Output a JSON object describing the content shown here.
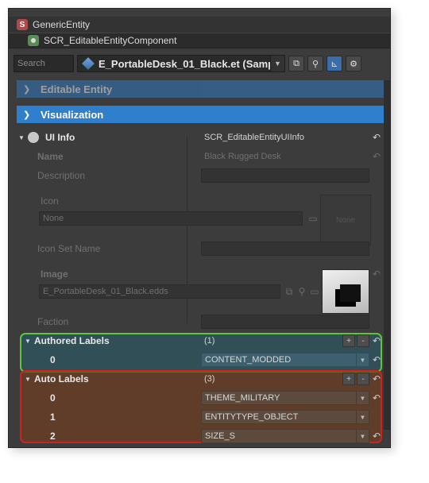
{
  "header": {
    "entity_title": "GenericEntity",
    "component_title": "SCR_EditableEntityComponent"
  },
  "toolbar": {
    "search_placeholder": "Search",
    "path": "E_PortableDesk_01_Black.et (Samp"
  },
  "sections": {
    "editable_entity": "Editable Entity",
    "visualization": "Visualization"
  },
  "ui_info": {
    "label": "UI Info",
    "class": "SCR_EditableEntityUIInfo",
    "fields": {
      "name_label": "Name",
      "name_value": "Black Rugged Desk",
      "description_label": "Description",
      "icon_label": "Icon",
      "icon_value": "None",
      "icon_preview": "None",
      "icon_set_label": "Icon Set Name",
      "image_label": "Image",
      "image_value": "E_PortableDesk_01_Black.edds",
      "faction_label": "Faction"
    }
  },
  "authored_labels": {
    "label": "Authored Labels",
    "count": "(1)",
    "items": [
      {
        "index": "0",
        "value": "CONTENT_MODDED"
      }
    ]
  },
  "auto_labels": {
    "label": "Auto Labels",
    "count": "(3)",
    "items": [
      {
        "index": "0",
        "value": "THEME_MILITARY"
      },
      {
        "index": "1",
        "value": "ENTITYTYPE_OBJECT"
      },
      {
        "index": "2",
        "value": "SIZE_S"
      }
    ]
  },
  "colors": {
    "section_blue": "#2f7fcc",
    "highlight_green": "#5fc53c",
    "highlight_red": "#d12020"
  }
}
